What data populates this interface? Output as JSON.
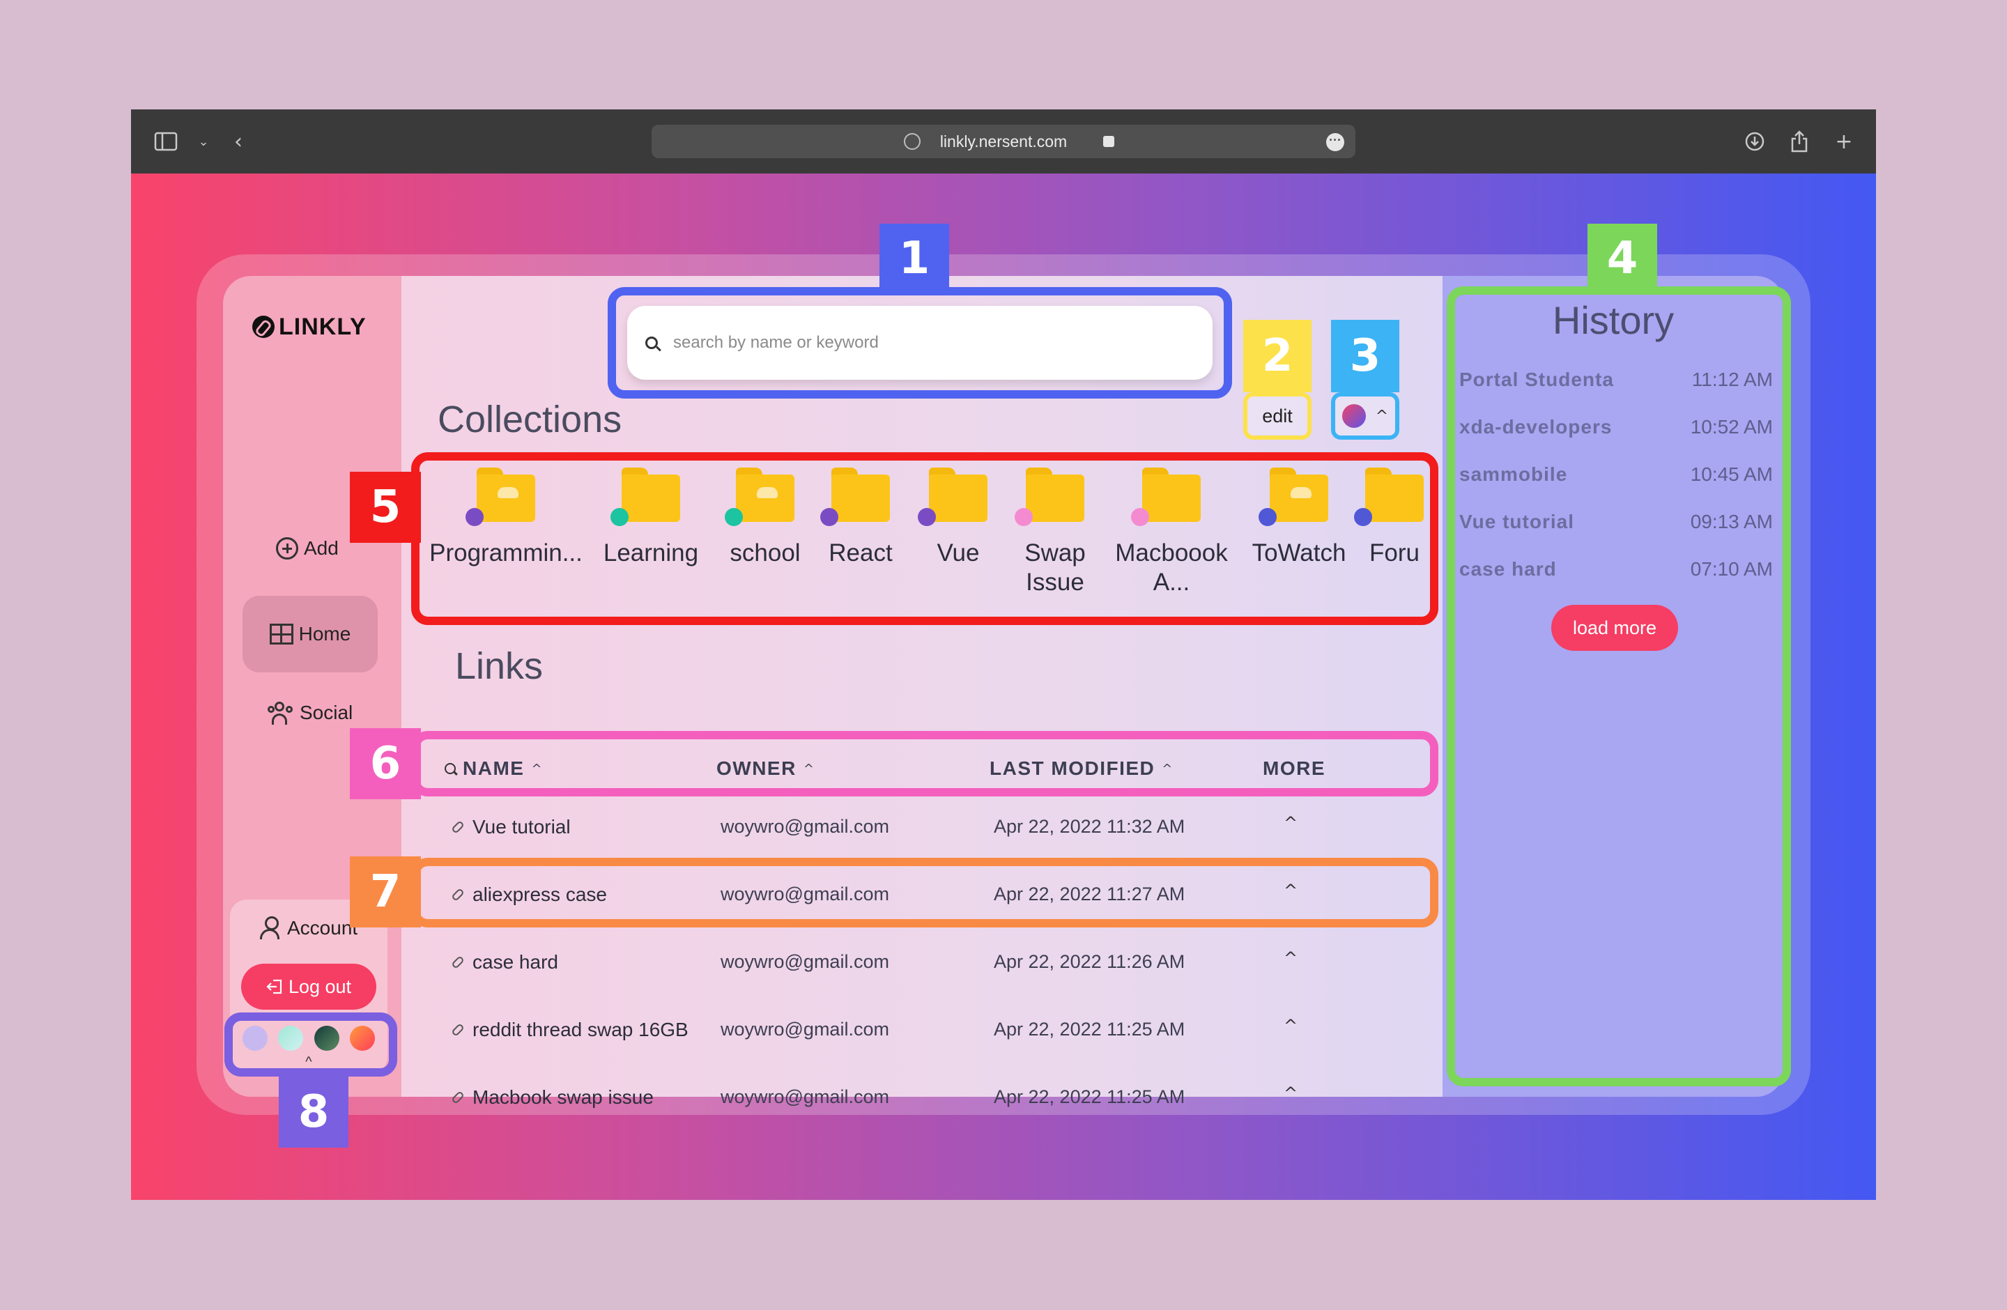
{
  "browser": {
    "url": "linkly.nersent.com",
    "icons": {
      "sidebar": "sidebar-toggle-icon",
      "back": "chevron-left-icon",
      "download": "download-icon",
      "share": "share-icon",
      "new_tab": "plus-icon"
    }
  },
  "app": {
    "logo_text": "LINKLY",
    "nav": {
      "add": "Add",
      "home": "Home",
      "social": "Social"
    },
    "account": {
      "label": "Account",
      "logout": "Log out"
    },
    "theme_colors": [
      "#c7b8f0",
      "linear-gradient(135deg,#9ee8d5,#d2f0f2)",
      "linear-gradient(135deg,#133a3a,#5d8c62)",
      "linear-gradient(135deg,#ff9a3c,#ff3d5a)"
    ],
    "search": {
      "placeholder": "search by name or keyword"
    },
    "edit_label": "edit",
    "collections_title": "Collections",
    "collections": [
      {
        "label": "Programmin...",
        "badge": "#7a4cc4",
        "cloud": true
      },
      {
        "label": "Learning",
        "badge": "#1cc4a1",
        "cloud": false
      },
      {
        "label": "school",
        "badge": "#1cc4a1",
        "cloud": true
      },
      {
        "label": "React",
        "badge": "#7a4cc4",
        "cloud": false
      },
      {
        "label": "Vue",
        "badge": "#7a4cc4",
        "cloud": false
      },
      {
        "label": "Swap\nIssue",
        "badge": "#f48bd1",
        "cloud": false
      },
      {
        "label": "Macboook\nA...",
        "badge": "#f48bd1",
        "cloud": false
      },
      {
        "label": "ToWatch",
        "badge": "#5058d6",
        "cloud": true
      },
      {
        "label": "Foru",
        "badge": "#5058d6",
        "cloud": false
      }
    ],
    "links_title": "Links",
    "table": {
      "headers": {
        "name": "NAME",
        "owner": "OWNER",
        "modified": "LAST MODIFIED",
        "more": "MORE"
      },
      "rows": [
        {
          "name": "Vue tutorial",
          "owner": "woywro@gmail.com",
          "modified": "Apr 22, 2022 11:32 AM"
        },
        {
          "name": "aliexpress case",
          "owner": "woywro@gmail.com",
          "modified": "Apr 22, 2022 11:27 AM"
        },
        {
          "name": "case hard",
          "owner": "woywro@gmail.com",
          "modified": "Apr 22, 2022 11:26 AM"
        },
        {
          "name": "reddit thread swap 16GB",
          "owner": "woywro@gmail.com",
          "modified": "Apr 22, 2022 11:25 AM"
        },
        {
          "name": "Macbook swap issue",
          "owner": "woywro@gmail.com",
          "modified": "Apr 22, 2022 11:25 AM"
        }
      ]
    },
    "history": {
      "title": "History",
      "items": [
        {
          "name": "Portal Studenta",
          "time": "11:12 AM"
        },
        {
          "name": "xda-developers",
          "time": "10:52 AM"
        },
        {
          "name": "sammobile",
          "time": "10:45 AM"
        },
        {
          "name": "Vue tutorial",
          "time": "09:13 AM"
        },
        {
          "name": "case hard",
          "time": "07:10 AM"
        }
      ],
      "load_more": "load more"
    }
  },
  "annotations": [
    {
      "number": "1",
      "color": "#4f63f0"
    },
    {
      "number": "2",
      "color": "#fde14a"
    },
    {
      "number": "3",
      "color": "#3bb3f5"
    },
    {
      "number": "4",
      "color": "#7bd65a"
    },
    {
      "number": "5",
      "color": "#f21c1c"
    },
    {
      "number": "6",
      "color": "#f45fbe"
    },
    {
      "number": "7",
      "color": "#f98a46"
    },
    {
      "number": "8",
      "color": "#7a5fe0"
    }
  ]
}
